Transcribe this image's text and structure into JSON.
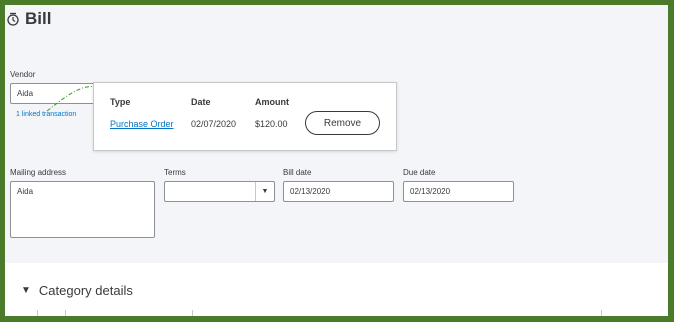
{
  "header": {
    "title": "Bill",
    "icon": "clock-icon"
  },
  "vendor": {
    "label": "Vendor",
    "value": "Aida",
    "linked_text": "1 linked transaction"
  },
  "linked_popover": {
    "columns": {
      "type": "Type",
      "date": "Date",
      "amount": "Amount"
    },
    "row": {
      "type": "Purchase Order",
      "date": "02/07/2020",
      "amount": "$120.00"
    },
    "remove_label": "Remove"
  },
  "mailing_address": {
    "label": "Mailing address",
    "value": "Aida"
  },
  "terms": {
    "label": "Terms",
    "value": ""
  },
  "bill_date": {
    "label": "Bill date",
    "value": "02/13/2020"
  },
  "due_date": {
    "label": "Due date",
    "value": "02/13/2020"
  },
  "category_details": {
    "title": "Category details",
    "expanded": true
  },
  "colors": {
    "link": "#0077c5",
    "annotation_arrow": "#2ca01c",
    "frame": "#4a7a2a"
  }
}
